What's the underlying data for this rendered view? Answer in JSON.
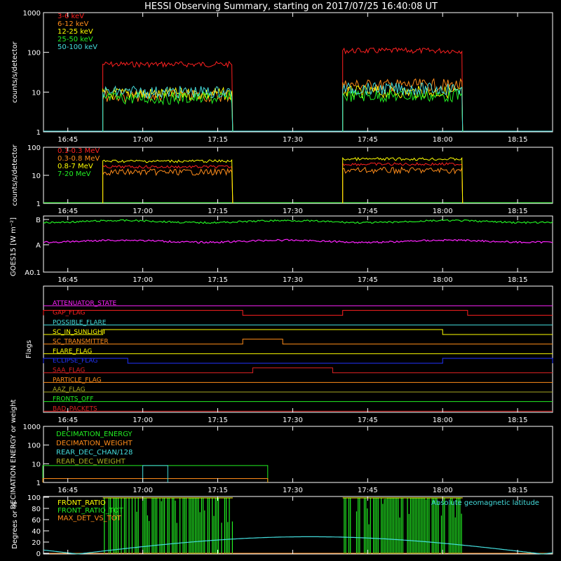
{
  "title": "HESSI Observing Summary, starting on 2017/07/25 16:40:08 UT",
  "colors": {
    "background": "#000000",
    "axes": "#ffffff",
    "red": "#ff2020",
    "orange": "#ff8c1a",
    "yellow": "#ffff00",
    "green": "#22ee22",
    "cyan": "#44dddd",
    "magenta": "#ff22ff",
    "blue": "#2233ff",
    "olive": "#aaaa22",
    "darkred": "#dd2222",
    "lightgreen": "#33ff33"
  },
  "time_ticks": [
    "16:45",
    "17:00",
    "17:15",
    "17:30",
    "17:45",
    "18:00",
    "18:15"
  ],
  "chart_data": [
    {
      "type": "line",
      "id": "low-energy",
      "ylabel": "counts/s/detector",
      "yscale": "log",
      "ylim": [
        1,
        1000
      ],
      "ytick_labels": [
        "1",
        "10",
        "100",
        "1000"
      ],
      "xlim": [
        "16:40",
        "18:22"
      ],
      "series": [
        {
          "name": "3-6 keV",
          "color": "#ff2020",
          "segments": [
            [
              "16:52",
              "17:18",
              50
            ],
            [
              "17:40",
              "18:04",
              110
            ]
          ]
        },
        {
          "name": "6-12 keV",
          "color": "#ff8c1a",
          "segments": [
            [
              "16:52",
              "17:18",
              8
            ],
            [
              "17:40",
              "18:04",
              15
            ]
          ]
        },
        {
          "name": "12-25 keV",
          "color": "#ffff00",
          "segments": [
            [
              "16:52",
              "17:18",
              9
            ],
            [
              "17:40",
              "18:04",
              10
            ]
          ]
        },
        {
          "name": "25-50 keV",
          "color": "#22ee22",
          "segments": [
            [
              "16:52",
              "17:18",
              7
            ],
            [
              "17:40",
              "18:04",
              8
            ]
          ]
        },
        {
          "name": "50-100 keV",
          "color": "#44dddd",
          "segments": [
            [
              "16:52",
              "17:18",
              10
            ],
            [
              "17:40",
              "18:04",
              12
            ]
          ]
        }
      ]
    },
    {
      "type": "line",
      "id": "high-energy",
      "ylabel": "counts/s/detector",
      "yscale": "log",
      "ylim": [
        1,
        100
      ],
      "ytick_labels": [
        "1",
        "10",
        "100"
      ],
      "xlim": [
        "16:40",
        "18:22"
      ],
      "series": [
        {
          "name": "0.1-0.3 MeV",
          "color": "#ff2020",
          "segments": [
            [
              "16:52",
              "17:18",
              20
            ],
            [
              "17:40",
              "18:04",
              25
            ]
          ]
        },
        {
          "name": "0.3-0.8 MeV",
          "color": "#ff8c1a",
          "segments": [
            [
              "16:52",
              "17:18",
              13
            ],
            [
              "17:40",
              "18:04",
              15
            ]
          ]
        },
        {
          "name": "0.8-7 MeV",
          "color": "#ffff00",
          "segments": [
            [
              "16:52",
              "17:18",
              32
            ],
            [
              "17:40",
              "18:04",
              38
            ]
          ]
        },
        {
          "name": "7-20 MeV",
          "color": "#22ee22",
          "segments": []
        }
      ]
    },
    {
      "type": "line",
      "id": "goes",
      "ylabel": "GOES15 [W m⁻²]",
      "ytick_labels": [
        "A0.1",
        "A",
        "B"
      ],
      "series": [
        {
          "color": "#22ee22",
          "level_class": "B-",
          "level": 0.9
        },
        {
          "color": "#ff22ff",
          "level_class": "A+",
          "level": 0.55
        }
      ]
    },
    {
      "type": "table",
      "id": "flags",
      "ylabel": "Flags",
      "rows": [
        {
          "name": "ATTENUATOR_STATE",
          "color": "#ff22ff",
          "high": []
        },
        {
          "name": "GAP_FLAG",
          "color": "#ff2020",
          "high": [
            [
              "16:40",
              "17:20"
            ],
            [
              "17:40",
              "18:05"
            ]
          ]
        },
        {
          "name": "POSSIBLE_FLARE",
          "color": "#44dddd",
          "high": []
        },
        {
          "name": "SC_IN_SUNLIGHT",
          "color": "#ffff00",
          "high": [
            [
              "16:52",
              "18:00"
            ]
          ]
        },
        {
          "name": "SC_TRANSMITTER",
          "color": "#ff8c1a",
          "high": [
            [
              "17:20",
              "17:28"
            ]
          ]
        },
        {
          "name": "FLARE_FLAG",
          "color": "#ffff00",
          "high": []
        },
        {
          "name": "ECLIPSE_FLAG",
          "color": "#2233ff",
          "high": [
            [
              "16:40",
              "16:57"
            ],
            [
              "18:00",
              "18:22"
            ]
          ]
        },
        {
          "name": "SAA_FLAG",
          "color": "#dd2222",
          "high": [
            [
              "17:22",
              "17:38"
            ]
          ]
        },
        {
          "name": "PARTICLE_FLAG",
          "color": "#ff8c1a",
          "high": []
        },
        {
          "name": "AAZ_FLAG",
          "color": "#aaaa22",
          "high": []
        },
        {
          "name": "FRONTS_OFF",
          "color": "#22ee22",
          "high": []
        },
        {
          "name": "BAD_PACKETS",
          "color": "#dd2222",
          "high": []
        }
      ]
    },
    {
      "type": "line",
      "id": "decimation",
      "ylabel": "DECIMATION ENERGY or weight",
      "yscale": "log",
      "ylim": [
        1,
        1000
      ],
      "ytick_labels": [
        "1",
        "10",
        "100",
        "1000"
      ],
      "series": [
        {
          "name": "DECIMATION_ENERGY",
          "color": "#22ee22",
          "segments": [
            [
              "16:40",
              "17:25",
              8
            ]
          ]
        },
        {
          "name": "DECIMATION_WEIGHT",
          "color": "#ff8c1a",
          "segments": [
            [
              "16:40",
              "17:25",
              1.6
            ]
          ]
        },
        {
          "name": "REAR_DEC_CHAN/128",
          "color": "#44dddd",
          "segments": [
            [
              "17:00",
              "17:05",
              8
            ]
          ]
        },
        {
          "name": "REAR_DEC_WEIGHT",
          "color": "#aaaa22",
          "segments": []
        }
      ]
    },
    {
      "type": "line",
      "id": "ratios",
      "ylabel": "Degrees or %",
      "ylim": [
        0,
        100
      ],
      "ytick_labels": [
        "0",
        "20",
        "40",
        "60",
        "80",
        "100"
      ],
      "series": [
        {
          "name": "FRONT_RATIO",
          "color": "#ffff00"
        },
        {
          "name": "FRONT_RATIO_TOT",
          "color": "#22ee22",
          "segments": [
            [
              "16:52",
              "17:18"
            ],
            [
              "17:40",
              "18:04"
            ]
          ]
        },
        {
          "name": "MAX_DET_VS_TOT",
          "color": "#ff8c1a"
        }
      ],
      "annotation": "Absolute geomagnetic latitude",
      "annotation_color": "#44dddd"
    }
  ]
}
